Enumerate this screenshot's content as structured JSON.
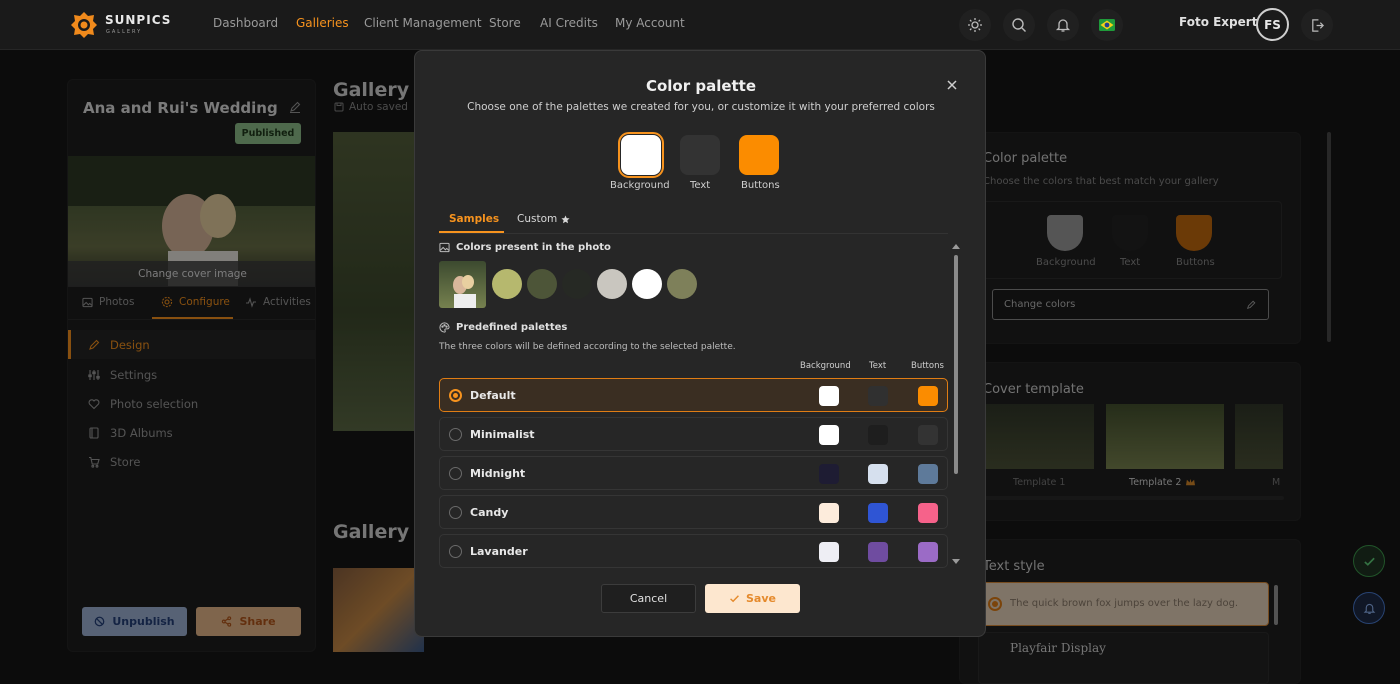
{
  "brand": {
    "name": "SUNPICS",
    "sub": "GALLERY"
  },
  "nav": {
    "items": [
      "Dashboard",
      "Galleries",
      "Client Management",
      "Store",
      "AI Credits",
      "My Account"
    ],
    "active": "Galleries"
  },
  "user": {
    "name": "Foto Expert",
    "initials": "FS"
  },
  "colors": {
    "accent": "#f7931e",
    "published": "#8fbf8a"
  },
  "sidebar": {
    "gallery_title": "Ana and Rui's Wedding",
    "status": "Published",
    "cover_button": "Change cover image",
    "tabs": [
      "Photos",
      "Configure",
      "Activities"
    ],
    "menu": [
      "Design",
      "Settings",
      "Photo selection",
      "3D Albums",
      "Store"
    ],
    "unpublish": "Unpublish",
    "share": "Share"
  },
  "main": {
    "heading1": "Gallery D",
    "autosave": "Auto saved",
    "heading2": "Gallery G"
  },
  "right": {
    "palette_title": "Color palette",
    "palette_sub": "Choose the colors that best match your gallery",
    "swatch_labels": [
      "Background",
      "Text",
      "Buttons"
    ],
    "change_colors": "Change colors",
    "cover_title": "Cover template",
    "templates": [
      "Template 1",
      "Template 2",
      "M"
    ],
    "text_style_title": "Text style",
    "sample_text": "The quick brown fox jumps over the lazy dog.",
    "font_option": "Playfair Display"
  },
  "modal": {
    "title": "Color palette",
    "subtitle": "Choose one of the palettes we created for you, or customize it with your preferred colors",
    "swatch_labels": [
      "Background",
      "Text",
      "Buttons"
    ],
    "swatch_colors": [
      "#ffffff",
      "#333333",
      "#fb8c00"
    ],
    "tabs": [
      "Samples",
      "Custom"
    ],
    "photo_section": "Colors present in the photo",
    "photo_colors": [
      "#b6b86e",
      "#4d5538",
      "#262924",
      "#c9c6bf",
      "#ffffff",
      "#7e805a"
    ],
    "predef_section": "Predefined palettes",
    "predef_note": "The three colors will be defined according to the selected palette.",
    "col_headers": [
      "Background",
      "Text",
      "Buttons"
    ],
    "palettes": [
      {
        "name": "Default",
        "colors": [
          "#ffffff",
          "#303030",
          "#fb8c00"
        ],
        "selected": true
      },
      {
        "name": "Minimalist",
        "colors": [
          "#ffffff",
          "#1e1e1e",
          "#333333"
        ],
        "selected": false
      },
      {
        "name": "Midnight",
        "colors": [
          "#1e1c33",
          "#d6e0ee",
          "#5e7a9a"
        ],
        "selected": false
      },
      {
        "name": "Candy",
        "colors": [
          "#fdecdc",
          "#2f55d4",
          "#f6628a"
        ],
        "selected": false
      },
      {
        "name": "Lavander",
        "colors": [
          "#eeeef4",
          "#6f4ca0",
          "#9b6bc6"
        ],
        "selected": false
      }
    ],
    "cancel": "Cancel",
    "save": "Save"
  }
}
